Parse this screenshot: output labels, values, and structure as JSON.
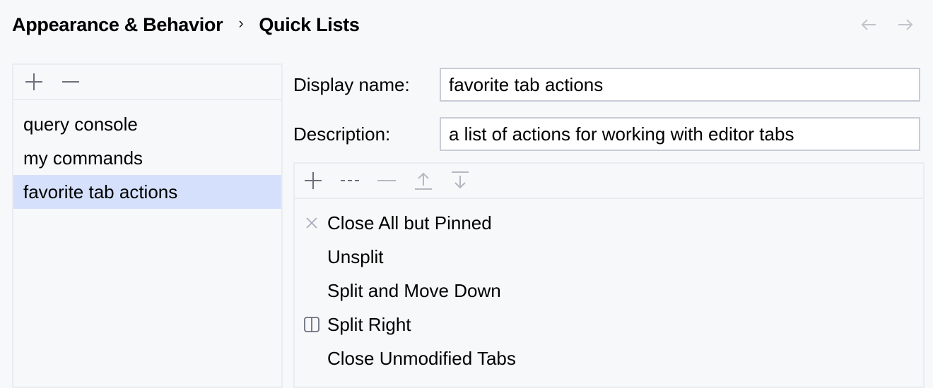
{
  "breadcrumb": {
    "parent": "Appearance & Behavior",
    "separator": "›",
    "current": "Quick Lists"
  },
  "nav": {
    "back_icon": "arrow-left-icon",
    "forward_icon": "arrow-right-icon"
  },
  "quick_lists": {
    "toolbar": {
      "add_icon": "plus-icon",
      "remove_icon": "minus-icon"
    },
    "items": [
      {
        "label": "query console",
        "selected": false
      },
      {
        "label": "my commands",
        "selected": false
      },
      {
        "label": "favorite tab actions",
        "selected": true
      }
    ]
  },
  "form": {
    "display_name_label": "Display name:",
    "display_name_value": "favorite tab actions",
    "description_label": "Description:",
    "description_value": "a list of actions for working with editor tabs"
  },
  "actions": {
    "toolbar": {
      "add_icon": "plus-icon",
      "separator_icon": "add-separator-icon",
      "remove_icon": "minus-icon",
      "move_up_icon": "move-up-icon",
      "move_down_icon": "move-down-icon"
    },
    "items": [
      {
        "label": "Close All but Pinned",
        "icon": "close-icon"
      },
      {
        "label": "Unsplit",
        "icon": ""
      },
      {
        "label": "Split and Move Down",
        "icon": ""
      },
      {
        "label": "Split Right",
        "icon": "split-vertical-icon"
      },
      {
        "label": "Close Unmodified Tabs",
        "icon": ""
      }
    ]
  },
  "colors": {
    "background": "#f7f8fa",
    "selection": "#d5e1fc",
    "border": "#ebecf0",
    "input_border": "#c9ccd6",
    "icon_active": "#6c707e",
    "icon_disabled": "#b4b8bf"
  }
}
